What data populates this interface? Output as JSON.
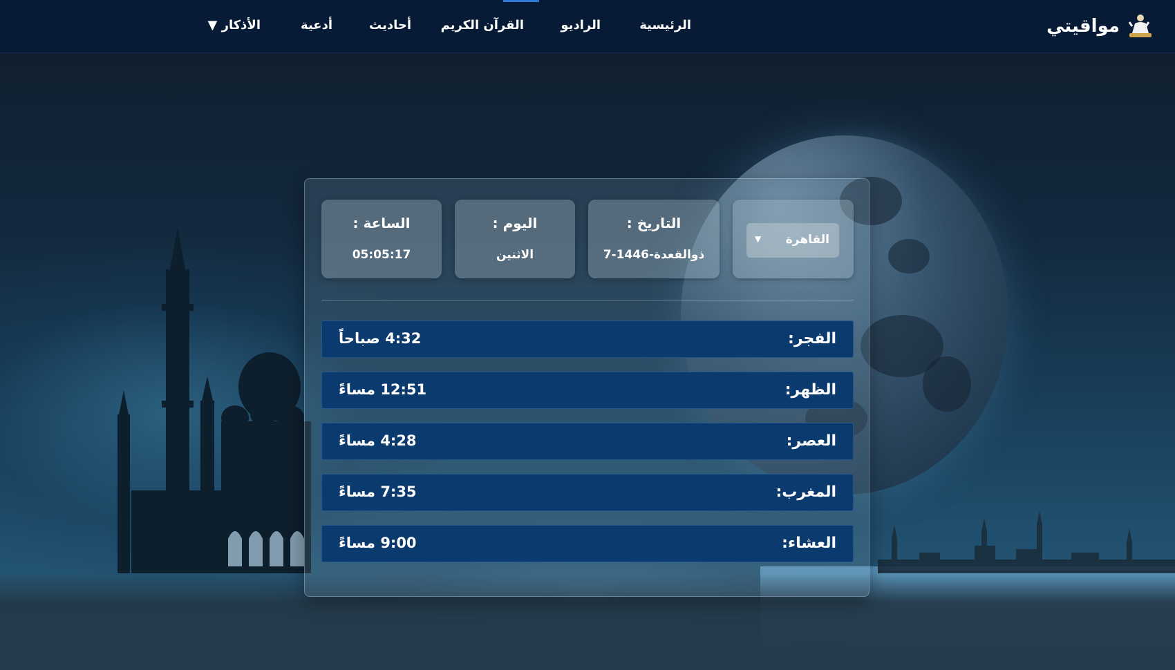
{
  "brand": {
    "name": "مواقيتي",
    "logo_icon": "praying-man-icon"
  },
  "nav": {
    "items": [
      {
        "label": "الرئيسية"
      },
      {
        "label": "الراديو"
      },
      {
        "label": "القرآن الكريم"
      },
      {
        "label": "أحاديث"
      },
      {
        "label": "أدعية"
      },
      {
        "label": "الأذكار ▼"
      }
    ],
    "active_accent_color": "#2f7bd6"
  },
  "info": {
    "city": {
      "selected": "القاهرة",
      "dropdown_icon": "caret-down-icon"
    },
    "date": {
      "label": "التاريخ :",
      "value": "7-ذوالقعدة-1446"
    },
    "day": {
      "label": "اليوم :",
      "value": "الاثنين"
    },
    "time": {
      "label": "الساعة :",
      "value": "05:05:17"
    }
  },
  "prayers": [
    {
      "name": "الفجر:",
      "time": "4:32 صباحاً"
    },
    {
      "name": "الظهر:",
      "time": "12:51 مساءً"
    },
    {
      "name": "العصر:",
      "time": "4:28 مساءً"
    },
    {
      "name": "المغرب:",
      "time": "7:35 مساءً"
    },
    {
      "name": "العشاء:",
      "time": "9:00 مساءً"
    }
  ],
  "colors": {
    "navbar": "#081b36",
    "prayer_row": "#0b3a6e"
  }
}
